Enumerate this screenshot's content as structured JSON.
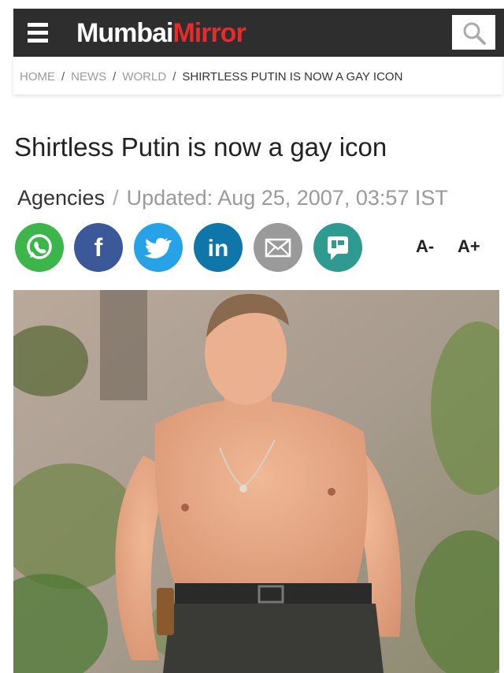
{
  "header": {
    "logo_part1": "Mumbai",
    "logo_part2": "Mirror",
    "brand_red": "#e52b2b",
    "bar_color": "#2e2e2e"
  },
  "breadcrumb": {
    "home": "HOME",
    "news": "NEWS",
    "world": "WORLD",
    "current": "SHIRTLESS PUTIN IS NOW A GAY ICON",
    "separator": "/"
  },
  "article": {
    "title": "Shirtless Putin is now a gay icon",
    "author": "Agencies",
    "meta_separator": "/",
    "updated": "Updated: Aug 25, 2007, 03:57 IST"
  },
  "share": {
    "whatsapp_color": "#3cb54a",
    "facebook_color": "#3b5998",
    "twitter_color": "#27a2e6",
    "linkedin_color": "#0e76a8",
    "email_color": "#9a9a9a",
    "comment_color": "#2f9a8f"
  },
  "font_controls": {
    "decrease": "A-",
    "increase": "A+"
  }
}
